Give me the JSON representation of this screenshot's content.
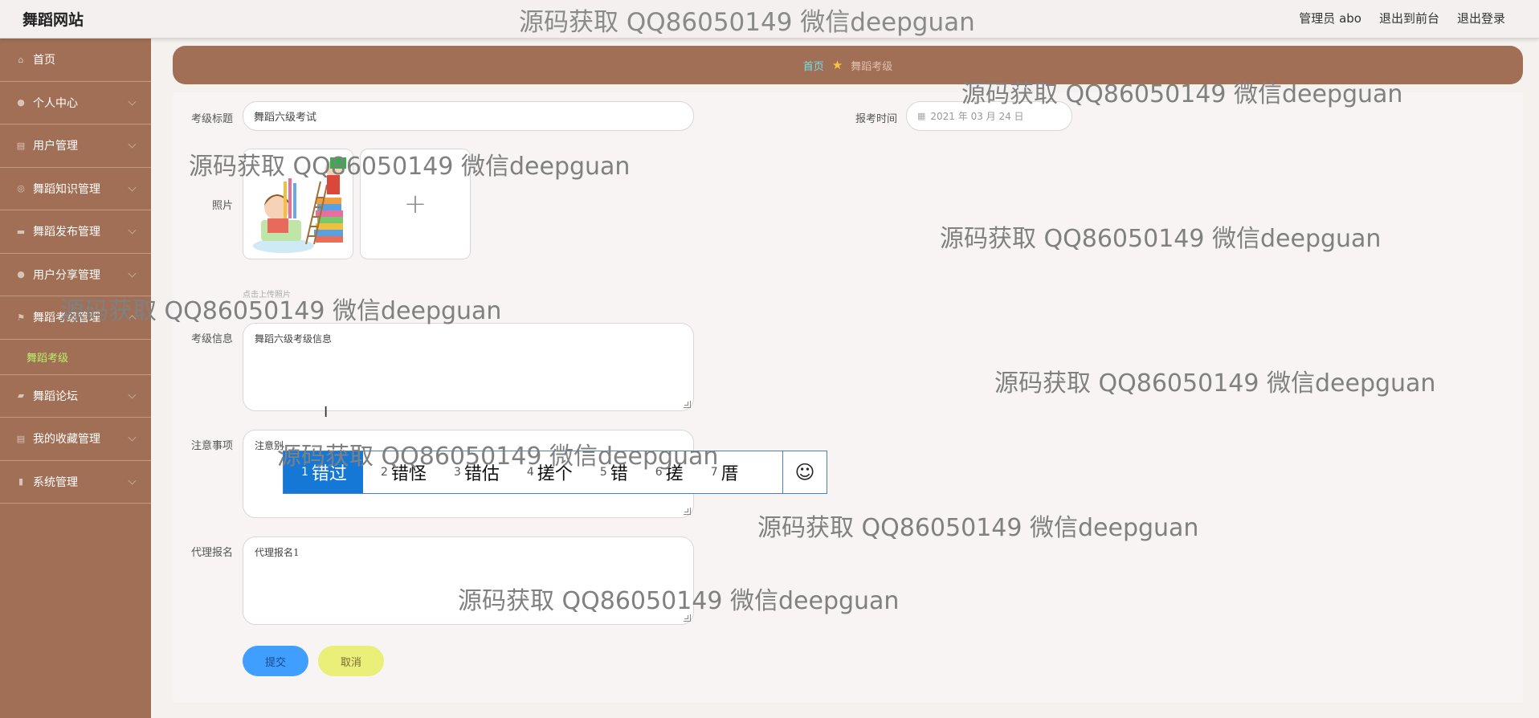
{
  "header": {
    "brand": "舞蹈网站",
    "watermark": "源码获取 QQ86050149 微信deepguan",
    "links": [
      "管理员 abo",
      "退出到前台",
      "退出登录"
    ]
  },
  "sidebar": {
    "items": [
      {
        "label": "首页",
        "icon": "home-icon"
      },
      {
        "label": "个人中心",
        "icon": "user-icon"
      },
      {
        "label": "用户管理",
        "icon": "clipboard-icon"
      },
      {
        "label": "舞蹈知识管理",
        "icon": "compass-icon"
      },
      {
        "label": "舞蹈发布管理",
        "icon": "briefcase-icon"
      },
      {
        "label": "用户分享管理",
        "icon": "location-icon"
      },
      {
        "label": "舞蹈考级管理",
        "icon": "flag-icon"
      },
      {
        "label": "舞蹈论坛",
        "icon": "chat-icon"
      },
      {
        "label": "我的收藏管理",
        "icon": "clipboard-icon"
      },
      {
        "label": "系统管理",
        "icon": "mic-icon"
      }
    ],
    "sub_item": "舞蹈考级"
  },
  "breadcrumb": {
    "home": "首页",
    "current": "舞蹈考级"
  },
  "form": {
    "title_label": "考级标题",
    "title_value": "舞蹈六级考试",
    "time_label": "报考时间",
    "time_value": "2021 年 03 月 24 日",
    "photo_label": "照片",
    "upload_add": "+",
    "upload_tip": "点击上传照片",
    "info_label": "考级信息",
    "info_value": "舞蹈六级考级信息",
    "notes_label": "注意事项",
    "notes_value": "注意别",
    "proxy_label": "代理报名",
    "proxy_value": "代理报名1",
    "submit": "提交",
    "cancel": "取消"
  },
  "ime": {
    "candidates": [
      {
        "num": "1",
        "text": "错过"
      },
      {
        "num": "2",
        "text": "错怪"
      },
      {
        "num": "3",
        "text": "错估"
      },
      {
        "num": "4",
        "text": "搓个"
      },
      {
        "num": "5",
        "text": "错"
      },
      {
        "num": "6",
        "text": "搓"
      },
      {
        "num": "7",
        "text": "厝"
      }
    ],
    "emoji": "☺"
  },
  "watermarks": [
    "源码获取 QQ86050149 微信deepguan",
    "源码获取 QQ86050149 微信deepguan",
    "源码获取 QQ86050149 微信deepguan",
    "源码获取 QQ86050149 微信deepguan",
    "源码获取 QQ86050149 微信deepguan",
    "源码获取 QQ86050149 微信deepguan",
    "源码获取 QQ86050149 微信deepguan",
    "源码获取 QQ86050149 微信deepguan"
  ],
  "colors": {
    "accent": "#a16f55",
    "sidebar_active": "#b7f06a",
    "submit": "#409eff",
    "cancel": "#e9ef78"
  }
}
